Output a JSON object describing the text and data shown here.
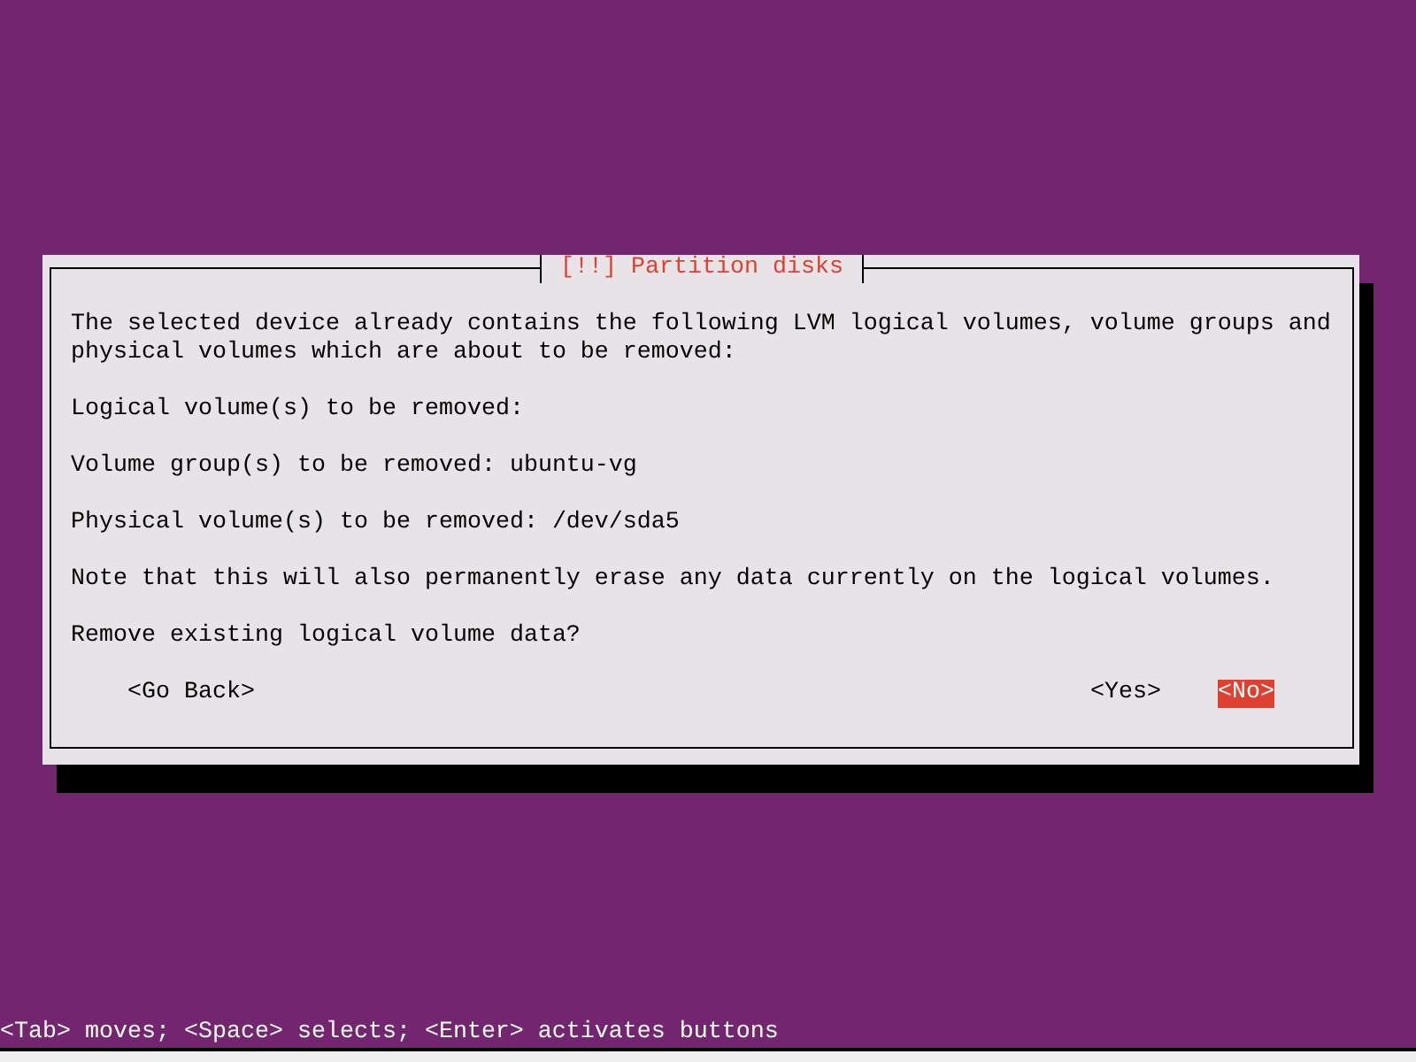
{
  "dialog": {
    "title": "[!!] Partition disks",
    "paragraphs": [
      "The selected device already contains the following LVM logical volumes, volume groups and physical volumes which are about to be removed:",
      "Logical volume(s) to be removed:",
      "Volume group(s) to be removed: ubuntu-vg",
      "Physical volume(s) to be removed: /dev/sda5",
      "Note that this will also permanently erase any data currently on the logical volumes.",
      "Remove existing logical volume data?"
    ],
    "buttons": [
      {
        "label": "<Go Back>",
        "selected": false
      },
      {
        "label": "<Yes>",
        "selected": false
      },
      {
        "label": "<No>",
        "selected": true
      }
    ]
  },
  "status_bar": {
    "text": "<Tab> moves; <Space> selects; <Enter> activates buttons"
  }
}
